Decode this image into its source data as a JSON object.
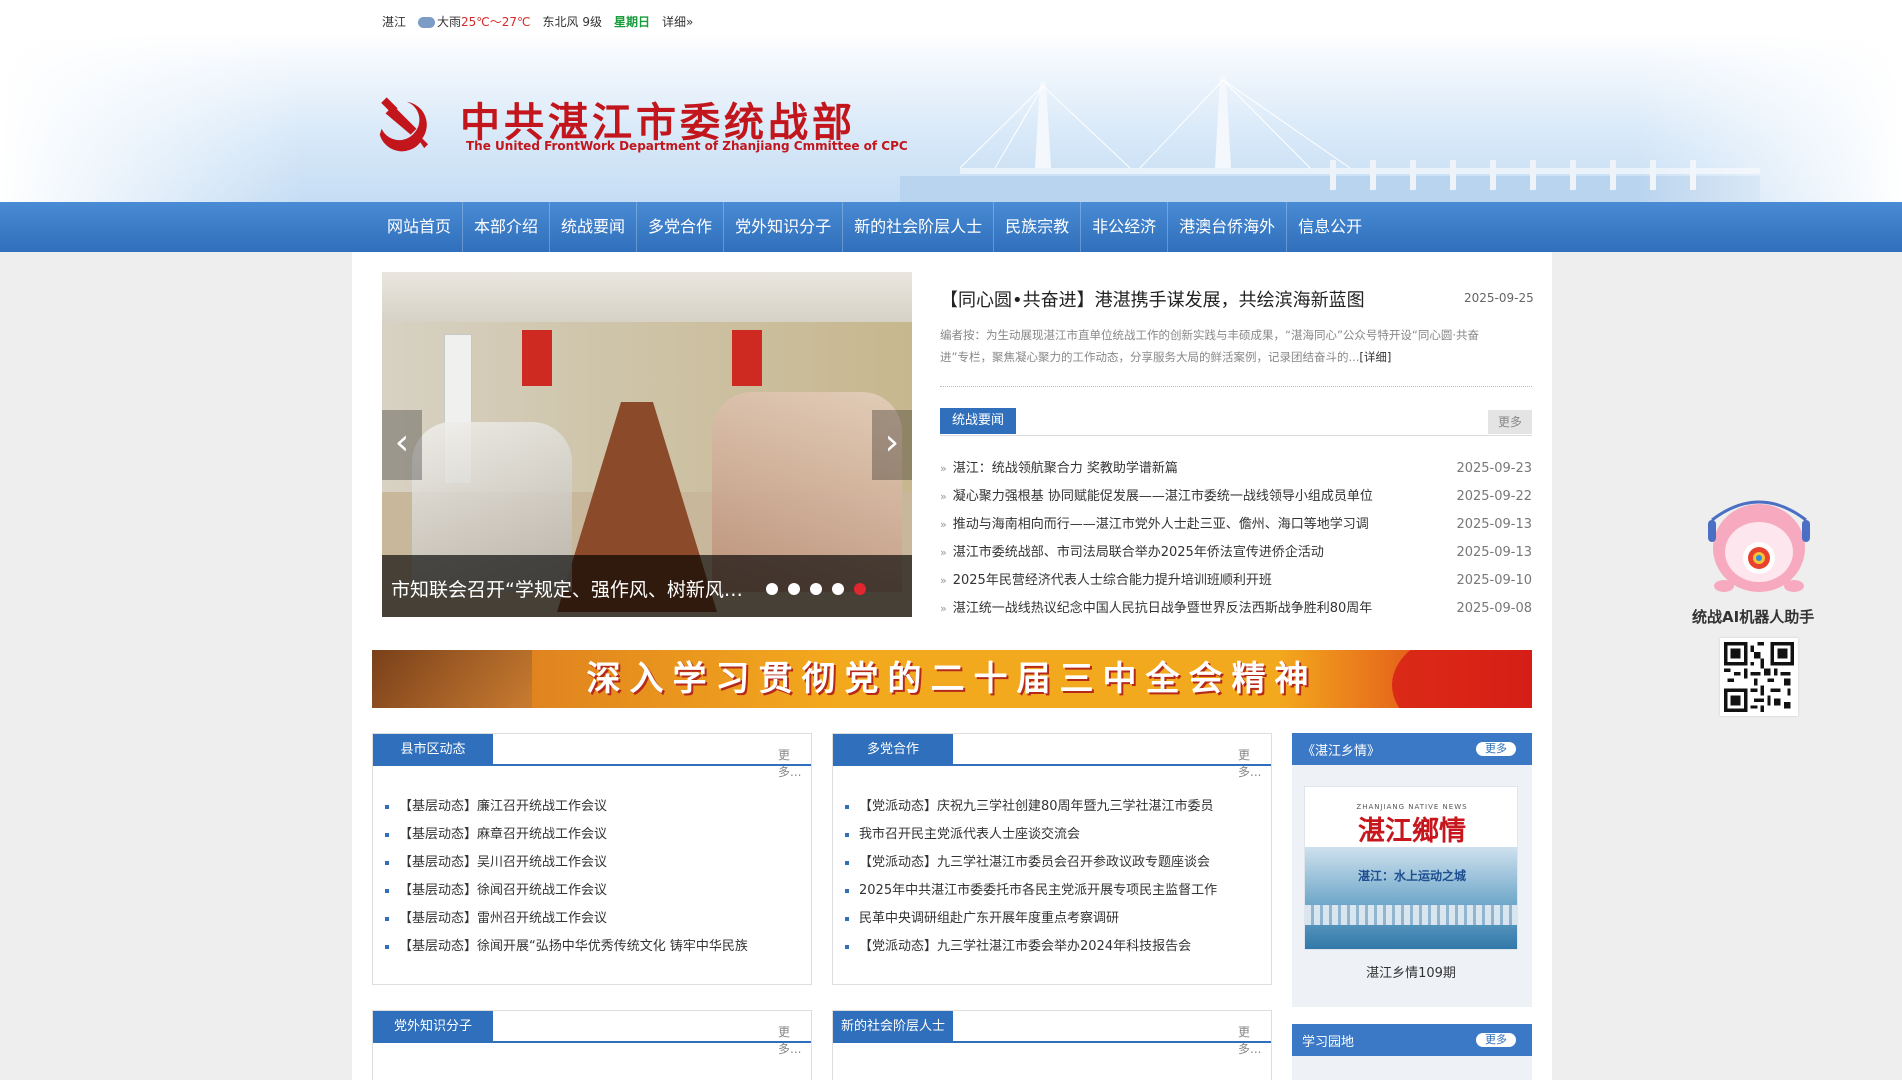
{
  "weather": {
    "city": "湛江",
    "condition": "大雨",
    "temp": "25℃～27℃",
    "wind": "东北风 9级",
    "weekday": "星期日",
    "detail": "详细»"
  },
  "header": {
    "title": "中共湛江市委统战部",
    "subtitle": "The United FrontWork Department of Zhanjiang Cmmittee of CPC"
  },
  "nav": [
    "网站首页",
    "本部介绍",
    "统战要闻",
    "多党合作",
    "党外知识分子",
    "新的社会阶层人士",
    "民族宗教",
    "非公经济",
    "港澳台侨海外",
    "信息公开"
  ],
  "slider": {
    "caption": "市知联会召开“学规定、强作风、树新风”主题交流会",
    "prev": "‹",
    "next": "›",
    "slide_count": 5,
    "active_slide": 5
  },
  "headline": {
    "title": "【同心圆•共奋进】港湛携手谋发展，共绘滨海新蓝图",
    "date": "2025-09-25",
    "summary": "编者按：为生动展现湛江市直单位统战工作的创新实践与丰硕成果，“湛海同心”公众号特开设“同心圆·共奋进”专栏，聚焦凝心聚力的工作动态，分享服务大局的鲜活案例，记录团结奋斗的...",
    "more": "[详细]"
  },
  "news": {
    "tab": "统战要闻",
    "more": "更多",
    "items": [
      {
        "title": "湛江：统战领航聚合力 奖教助学谱新篇",
        "date": "2025-09-23"
      },
      {
        "title": "凝心聚力强根基 协同赋能促发展——湛江市委统一战线领导小组成员单位",
        "date": "2025-09-22"
      },
      {
        "title": "推动与海南相向而行——湛江市党外人士赴三亚、儋州、海口等地学习调",
        "date": "2025-09-13"
      },
      {
        "title": "湛江市委统战部、市司法局联合举办2025年侨法宣传进侨企活动",
        "date": "2025-09-13"
      },
      {
        "title": "2025年民营经济代表人士综合能力提升培训班顺利开班",
        "date": "2025-09-10"
      },
      {
        "title": "湛江统一战线热议纪念中国人民抗日战争暨世界反法西斯战争胜利80周年",
        "date": "2025-09-08"
      }
    ]
  },
  "red_banner": "深入学习贯彻党的二十届三中全会精神",
  "county": {
    "title": "县市区动态",
    "more": "更多...",
    "items": [
      "【基层动态】廉江召开统战工作会议",
      "【基层动态】麻章召开统战工作会议",
      "【基层动态】吴川召开统战工作会议",
      "【基层动态】徐闻召开统战工作会议",
      "【基层动态】雷州召开统战工作会议",
      "【基层动态】徐闻开展“弘扬中华优秀传统文化 铸牢中华民族"
    ]
  },
  "multiparty": {
    "title": "多党合作",
    "more": "更多...",
    "items": [
      "【党派动态】庆祝九三学社创建80周年暨九三学社湛江市委员",
      "我市召开民主党派代表人士座谈交流会",
      "【党派动态】九三学社湛江市委员会召开参政议政专题座谈会",
      "2025年中共湛江市委委托市各民主党派开展专项民主监督工作",
      "民革中央调研组赴广东开展年度重点考察调研",
      "【党派动态】九三学社湛江市委会举办2024年科技报告会"
    ]
  },
  "hometown": {
    "title": "《湛江乡情》",
    "more": "更多",
    "cover_eng": "ZHANJIANG NATIVE NEWS",
    "cover_title": "湛江鄉情",
    "cover_sub": "湛江：水上运动之城",
    "caption": "湛江乡情109期"
  },
  "intellectuals": {
    "title": "党外知识分子",
    "more": "更多..."
  },
  "newclass": {
    "title": "新的社会阶层人士",
    "more": "更多..."
  },
  "study": {
    "title": "学习园地",
    "more": "更多"
  },
  "robot": {
    "label": "统战AI机器人助手"
  },
  "colors": {
    "nav": "#2f6fbb",
    "brand_red": "#c2161c",
    "background": "#eeeeee"
  }
}
